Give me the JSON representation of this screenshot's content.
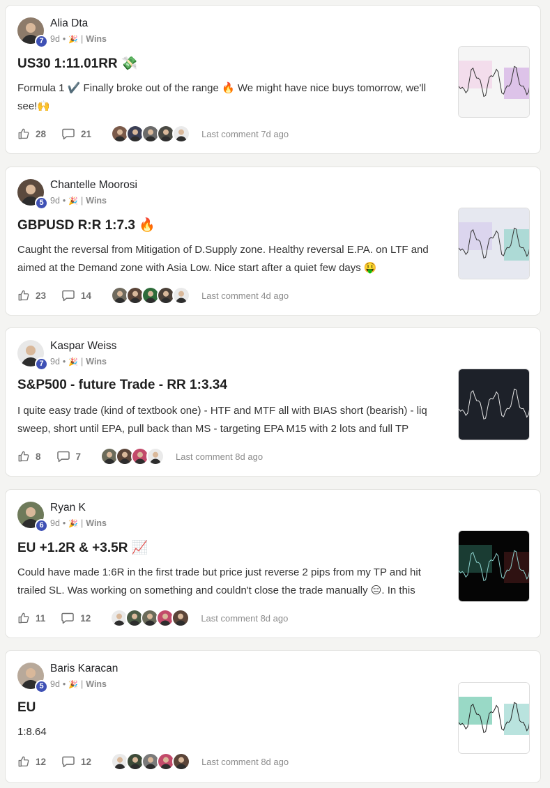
{
  "posts": [
    {
      "author": "Alia Dta",
      "level": "7",
      "age": "9d",
      "category": "Wins",
      "title": "US30 1:11.01RR 💸",
      "body": "Formula 1 ✔️ Finally broke out of the range 🔥 We might have nice buys tomorrow, we'll see!🙌",
      "likes": "28",
      "comments": "21",
      "last_comment": "Last comment 7d ago",
      "thumb_style": "light-pink",
      "avatar_color": "#8d7b6a",
      "commenter_colors": [
        "#7a5a4a",
        "#3b3f55",
        "#6a6a6a",
        "#4a4a44",
        "#eaeaea"
      ]
    },
    {
      "author": "Chantelle Moorosi",
      "level": "5",
      "age": "9d",
      "category": "Wins",
      "title": "GBPUSD R:R 1:7.3 🔥",
      "body": "Caught the reversal from Mitigation of D.Supply zone. Healthy reversal E.PA. on LTF and aimed at the Demand zone with Asia Low. Nice start after a quiet few days 🤑",
      "likes": "23",
      "comments": "14",
      "last_comment": "Last comment 4d ago",
      "thumb_style": "light-teal",
      "avatar_color": "#5b4a3e",
      "commenter_colors": [
        "#6f6a5e",
        "#5a4438",
        "#2e6b3a",
        "#4b4038",
        "#eaeaea"
      ]
    },
    {
      "author": "Kaspar Weiss",
      "level": "7",
      "age": "9d",
      "category": "Wins",
      "title": "S&P500 - future Trade - RR 1:3.34",
      "body": "I quite easy trade (kind of textbook one) - HTF and MTF all with BIAS short (bearish) - liq sweep, short until EPA, pull back than MS - targeting EPA M15 with 2 lots and full TP",
      "likes": "8",
      "comments": "7",
      "last_comment": "Last comment 8d ago",
      "thumb_style": "dark",
      "avatar_color": "#e8e8e8",
      "commenter_colors": [
        "#6b6b5a",
        "#5a4438",
        "#c24a6a",
        "#eaeaea"
      ]
    },
    {
      "author": "Ryan K",
      "level": "6",
      "age": "9d",
      "category": "Wins",
      "title": "EU +1.2R & +3.5R 📈",
      "body": "Could have made 1:6R in the first trade but price just reverse 2 pips from my TP and hit trailed SL. Was working on something and couldn't close the trade manually 😑. In this",
      "likes": "11",
      "comments": "12",
      "last_comment": "Last comment 8d ago",
      "thumb_style": "black",
      "avatar_color": "#6e7a5a",
      "commenter_colors": [
        "#eaeaea",
        "#4a5a44",
        "#6b6b5a",
        "#c24a6a",
        "#5a4438"
      ]
    },
    {
      "author": "Baris Karacan",
      "level": "5",
      "age": "9d",
      "category": "Wins",
      "title": "EU",
      "body": "1:8.64",
      "likes": "12",
      "comments": "12",
      "last_comment": "Last comment 8d ago",
      "thumb_style": "white-teal",
      "avatar_color": "#b8a99a",
      "commenter_colors": [
        "#eaeaea",
        "#3c4a38",
        "#7a7a7a",
        "#c24a6a",
        "#5a4438"
      ]
    }
  ]
}
